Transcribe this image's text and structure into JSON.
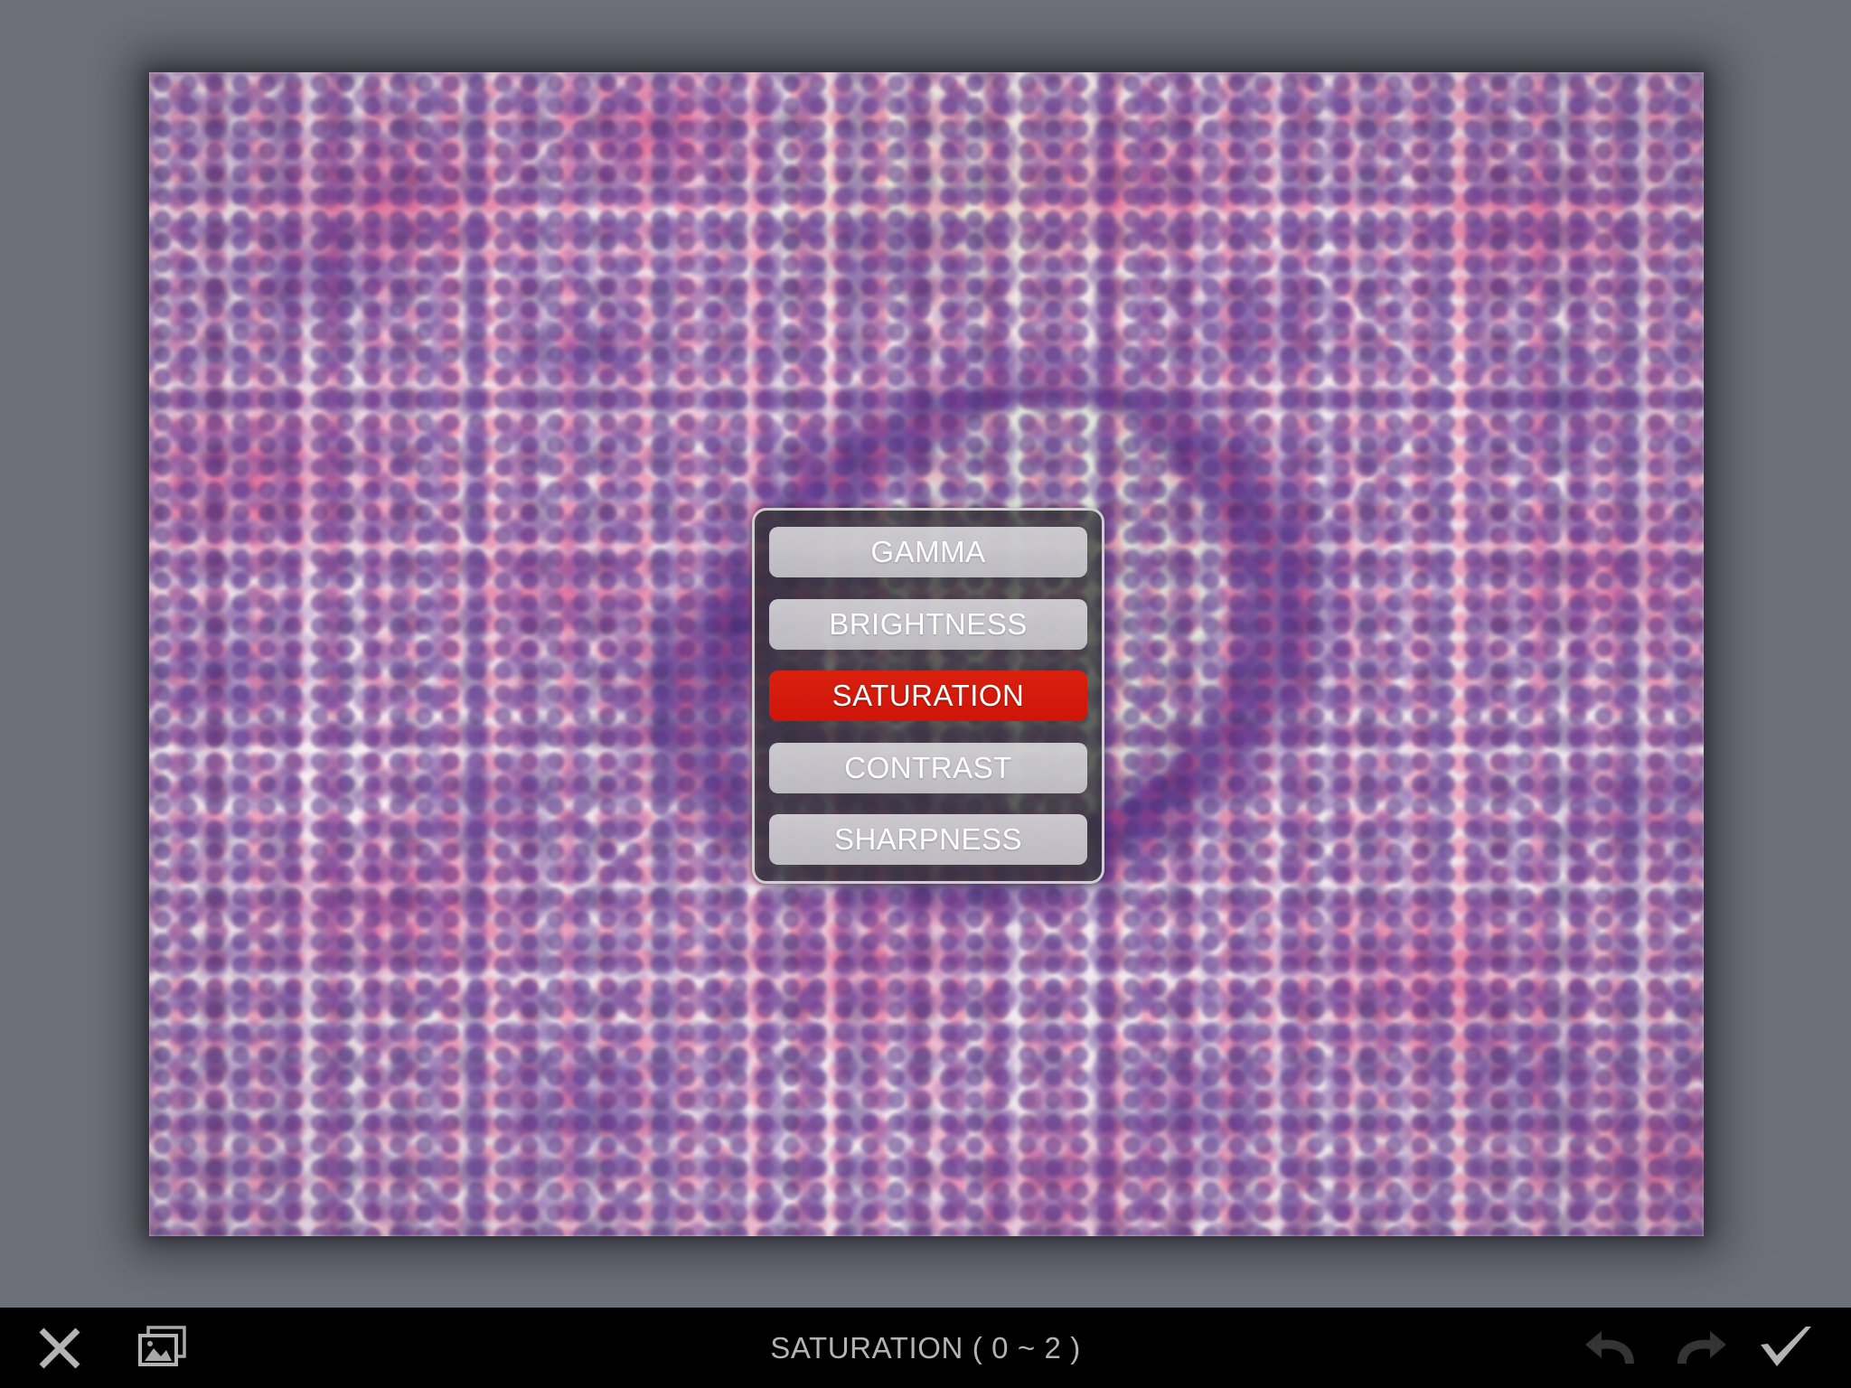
{
  "app": {
    "background_color": "#6d7079",
    "toolbar_background": "#000000"
  },
  "canvas": {
    "image_name": "histology-slide-photo",
    "image_description": "H&E stained lung histology micrograph with central bronchiole"
  },
  "adjust_menu": {
    "panel_name": "adjustment-menu",
    "selected_color": "#d6180d",
    "item_color": "#d8d8dc",
    "items": [
      {
        "id": "gamma",
        "label": "GAMMA",
        "selected": false
      },
      {
        "id": "brightness",
        "label": "BRIGHTNESS",
        "selected": false
      },
      {
        "id": "saturation",
        "label": "SATURATION",
        "selected": true
      },
      {
        "id": "contrast",
        "label": "CONTRAST",
        "selected": false
      },
      {
        "id": "sharpness",
        "label": "SHARPNESS",
        "selected": false
      }
    ]
  },
  "toolbar": {
    "status_label": "SATURATION ( 0 ~ 2 )",
    "status_color": "#b3b3b3",
    "left_buttons": [
      {
        "id": "close",
        "icon": "close-x-icon",
        "enabled": true
      },
      {
        "id": "gallery",
        "icon": "image-stack-icon",
        "enabled": true
      }
    ],
    "right_buttons": [
      {
        "id": "undo",
        "icon": "undo-arrow-icon",
        "enabled": false,
        "color": "#2e2e2e"
      },
      {
        "id": "redo",
        "icon": "redo-arrow-icon",
        "enabled": false,
        "color": "#2e2e2e"
      },
      {
        "id": "confirm",
        "icon": "checkmark-icon",
        "enabled": true,
        "color": "#b3b3b3"
      }
    ]
  }
}
